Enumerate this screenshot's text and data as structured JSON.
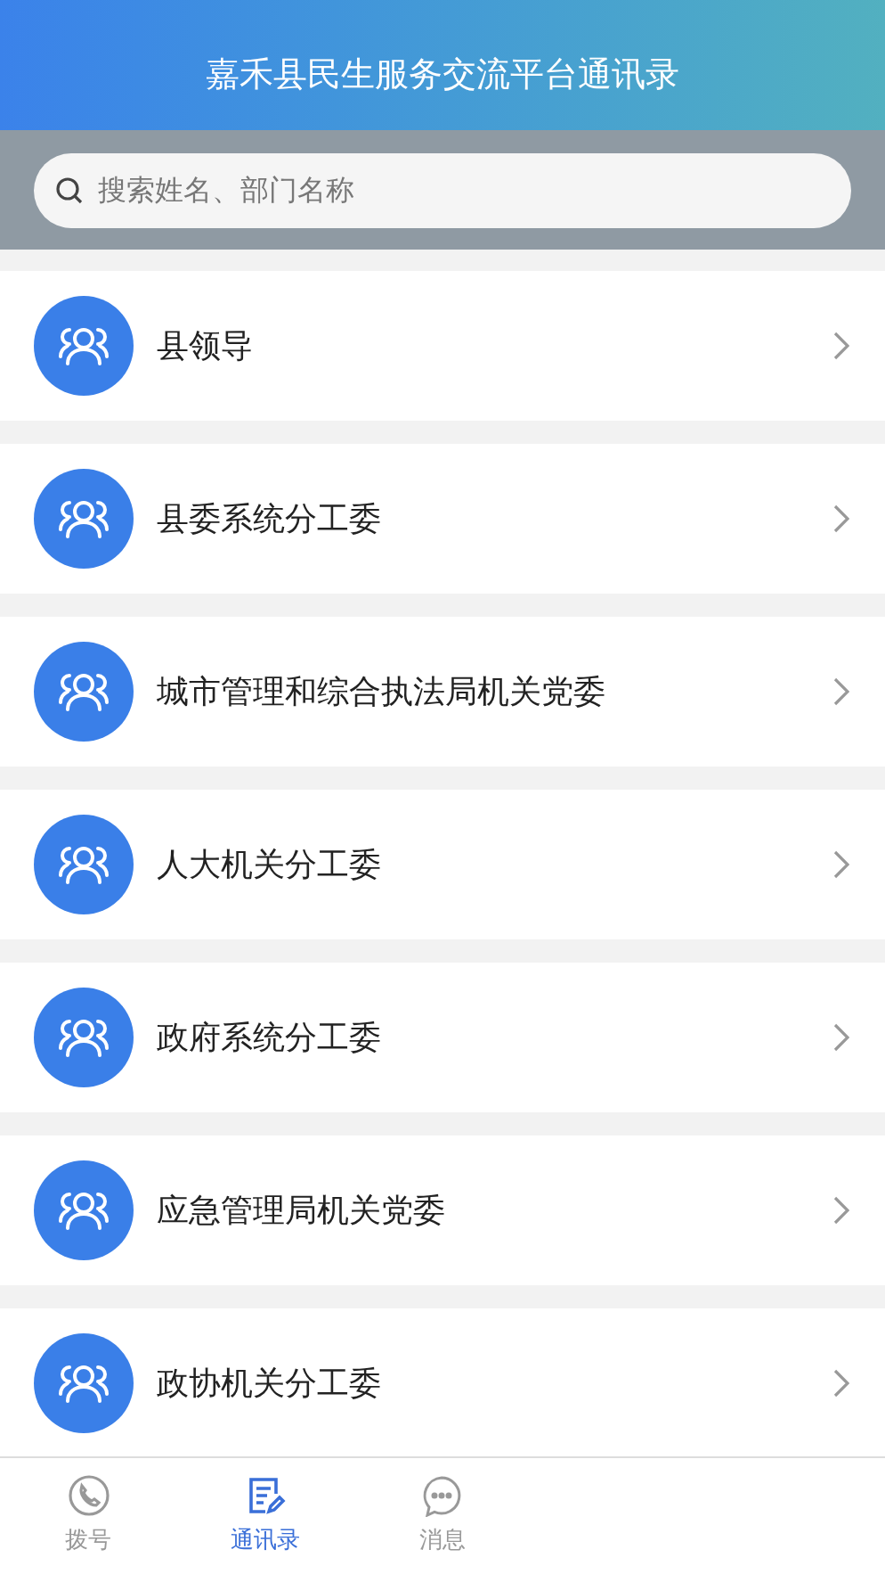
{
  "header": {
    "title": "嘉禾县民生服务交流平台通讯录"
  },
  "search": {
    "placeholder": "搜索姓名、部门名称"
  },
  "groups": [
    {
      "name": "县领导"
    },
    {
      "name": "县委系统分工委"
    },
    {
      "name": "城市管理和综合执法局机关党委"
    },
    {
      "name": "人大机关分工委"
    },
    {
      "name": "政府系统分工委"
    },
    {
      "name": "应急管理局机关党委"
    },
    {
      "name": "政协机关分工委"
    }
  ],
  "tabs": [
    {
      "label": "拨号",
      "kind": "phone",
      "selected": false
    },
    {
      "label": "通讯录",
      "kind": "contacts",
      "selected": true
    },
    {
      "label": "消息",
      "kind": "message",
      "selected": false
    }
  ]
}
